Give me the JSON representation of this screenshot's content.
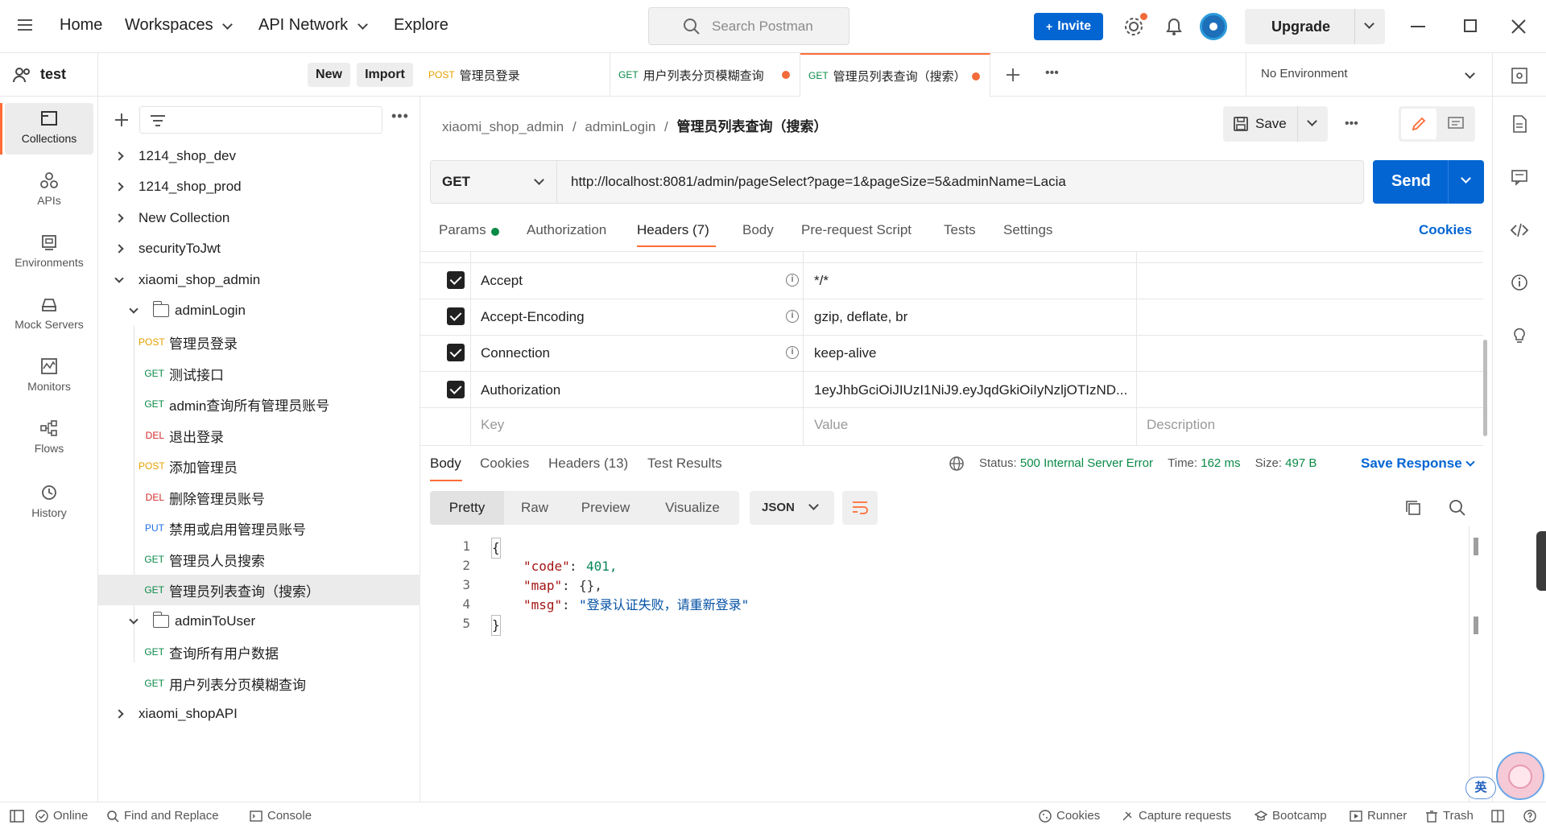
{
  "topbar": {
    "nav": [
      "Home",
      "Workspaces",
      "API Network",
      "Explore"
    ],
    "search_placeholder": "Search Postman",
    "invite_label": "Invite",
    "upgrade_label": "Upgrade"
  },
  "workspace": {
    "name": "test",
    "new_label": "New",
    "import_label": "Import"
  },
  "rail": [
    {
      "label": "Collections",
      "icon": "collections-icon"
    },
    {
      "label": "APIs",
      "icon": "apis-icon"
    },
    {
      "label": "Environments",
      "icon": "environments-icon"
    },
    {
      "label": "Mock Servers",
      "icon": "mock-servers-icon"
    },
    {
      "label": "Monitors",
      "icon": "monitors-icon"
    },
    {
      "label": "Flows",
      "icon": "flows-icon"
    },
    {
      "label": "History",
      "icon": "history-icon"
    }
  ],
  "tree": [
    {
      "label": "1214_shop_dev"
    },
    {
      "label": "1214_shop_prod"
    },
    {
      "label": "New Collection"
    },
    {
      "label": "securityToJwt"
    },
    {
      "label": "xiaomi_shop_admin"
    },
    {
      "label": "adminLogin"
    },
    {
      "method": "POST",
      "label": "管理员登录"
    },
    {
      "method": "GET",
      "label": "测试接口"
    },
    {
      "method": "GET",
      "label": "admin查询所有管理员账号"
    },
    {
      "method": "DEL",
      "label": "退出登录"
    },
    {
      "method": "POST",
      "label": "添加管理员"
    },
    {
      "method": "DEL",
      "label": "删除管理员账号"
    },
    {
      "method": "PUT",
      "label": "禁用或启用管理员账号"
    },
    {
      "method": "GET",
      "label": "管理员人员搜索"
    },
    {
      "method": "GET",
      "label": "管理员列表查询（搜索）"
    },
    {
      "label": "adminToUser"
    },
    {
      "method": "GET",
      "label": "查询所有用户数据"
    },
    {
      "method": "GET",
      "label": "用户列表分页模糊查询"
    },
    {
      "label": "xiaomi_shopAPI"
    }
  ],
  "tabs": [
    {
      "method": "POST",
      "label": "管理员登录"
    },
    {
      "method": "GET",
      "label": "用户列表分页模糊查询"
    },
    {
      "method": "GET",
      "label": "管理员列表查询（搜索）"
    }
  ],
  "environment": "No Environment",
  "breadcrumb": {
    "collection": "xiaomi_shop_admin",
    "folder": "adminLogin",
    "request": "管理员列表查询（搜索）",
    "sep": "/"
  },
  "save_label": "Save",
  "request": {
    "method": "GET",
    "url": "http://localhost:8081/admin/pageSelect?page=1&pageSize=5&adminName=Lacia",
    "send_label": "Send"
  },
  "req_tabs": [
    "Params",
    "Authorization",
    "Headers (7)",
    "Body",
    "Pre-request Script",
    "Tests",
    "Settings"
  ],
  "cookies_label": "Cookies",
  "headers": [
    {
      "key": "Accept",
      "value": "*/*"
    },
    {
      "key": "Accept-Encoding",
      "value": "gzip, deflate, br"
    },
    {
      "key": "Connection",
      "value": "keep-alive"
    },
    {
      "key": "Authorization",
      "value": "1eyJhbGciOiJIUzI1NiJ9.eyJqdGkiOiIyNzljOTIzND..."
    }
  ],
  "header_placeholders": {
    "key": "Key",
    "value": "Value",
    "description": "Description"
  },
  "response": {
    "tabs": [
      "Body",
      "Cookies",
      "Headers (13)",
      "Test Results"
    ],
    "status_label": "Status:",
    "status_value": "500 Internal Server Error",
    "time_label": "Time:",
    "time_value": "162 ms",
    "size_label": "Size:",
    "size_value": "497 B",
    "save_response": "Save Response",
    "formats": [
      "Pretty",
      "Raw",
      "Preview",
      "Visualize"
    ],
    "lang": "JSON",
    "line_numbers": [
      "1",
      "2",
      "3",
      "4",
      "5"
    ],
    "lines": [
      {
        "key": "\"code\"",
        "value": "401,"
      },
      {
        "key": "\"map\"",
        "value": "{},"
      },
      {
        "key": "\"msg\"",
        "value": "\"登录认证失败，请重新登录\""
      }
    ],
    "open_brace": "{",
    "close_brace": "}"
  },
  "statusbar": {
    "left": [
      "Online",
      "Find and Replace",
      "Console"
    ],
    "right": [
      "Cookies",
      "Capture requests",
      "Bootcamp",
      "Runner",
      "Trash"
    ]
  },
  "ime_label": "英",
  "colors": {
    "accent": "#ff6c37",
    "primary": "#0265d2",
    "status_ok": "#0a8a47"
  }
}
